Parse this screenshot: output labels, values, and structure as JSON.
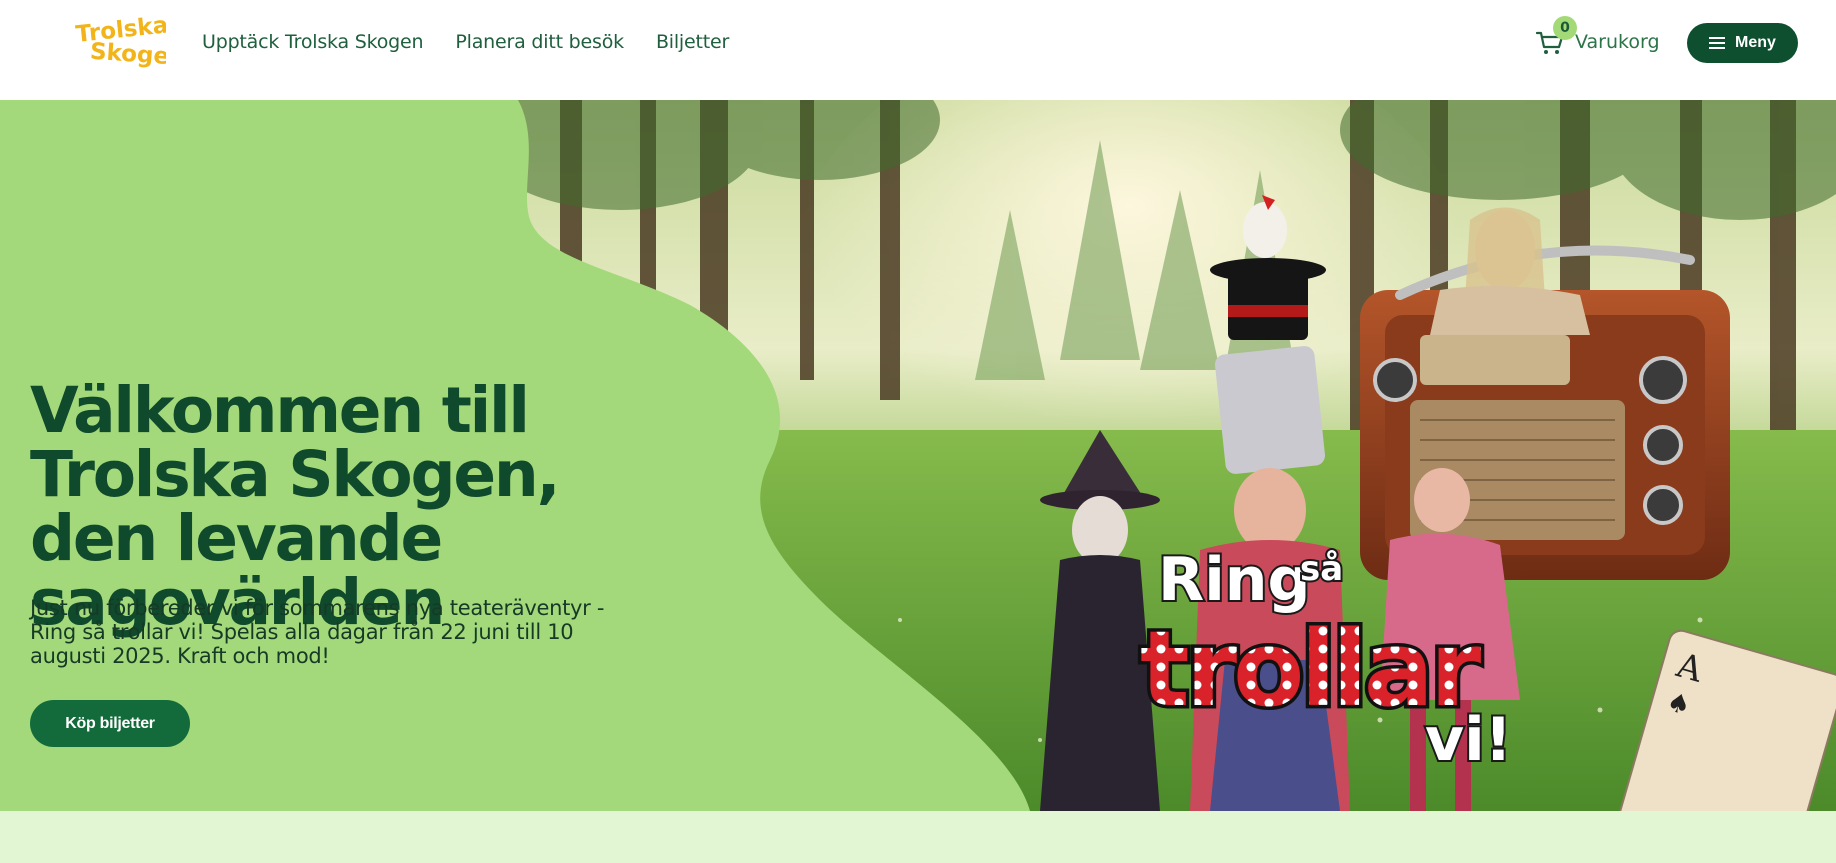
{
  "header": {
    "logo": {
      "line1": "Trolska",
      "line2": "Skogen"
    },
    "nav": [
      {
        "label": "Upptäck Trolska Skogen"
      },
      {
        "label": "Planera ditt besök"
      },
      {
        "label": "Biljetter"
      }
    ],
    "cart": {
      "count": "0",
      "label": "Varukorg"
    },
    "menu": {
      "label": "Meny"
    }
  },
  "hero": {
    "title": "Välkommen till Trolska Skogen, den levande sagovärlden",
    "text": "Just nu förbereder vi för sommarens nya teateräventyr - Ring så trollar vi! Spelas alla dagar från 22 juni till 10 augusti 2025. Kraft och mod!",
    "cta_label": "Köp biljetter",
    "show_logo": {
      "line1": "Ring",
      "line1b": "så",
      "line2": "trollar",
      "line3": "vi!"
    }
  },
  "colors": {
    "brand_dark": "#0e4f2f",
    "brand_green": "#136b3b",
    "hero_green": "#a3d97a",
    "nav_text": "#1f5f3e",
    "logo_yellow": "#f2b418",
    "band": "#e3f6d4"
  },
  "icons": [
    "cart-icon",
    "hamburger-icon"
  ]
}
